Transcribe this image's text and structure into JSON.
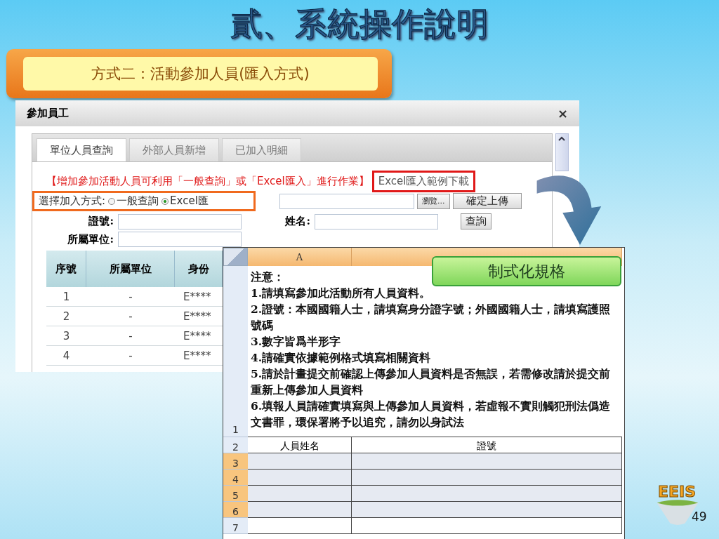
{
  "slide": {
    "title": "貳、系統操作說明",
    "callout": "方式二：活動參加人員(匯入方式)",
    "logo": "EEIS",
    "page_number": "49"
  },
  "dialog": {
    "title": "參加員工",
    "close": "×",
    "tabs": [
      {
        "label": "單位人員查詢",
        "selected": true
      },
      {
        "label": "外部人員新增",
        "selected": false
      },
      {
        "label": "已加入明細",
        "selected": false
      }
    ],
    "notice": "【增加參加活動人員可利用「一般查詢」或「Excel匯入」進行作業】",
    "sample_link": "Excel匯入範例下載",
    "mode_label": "選擇加入方式:",
    "modes": [
      {
        "label": "一般查詢",
        "selected": false
      },
      {
        "label": "Excel匯",
        "selected": true
      }
    ],
    "browse_button": "瀏覽...",
    "upload_button": "確定上傳",
    "id_label": "證號:",
    "name_label": "姓名:",
    "search_button": "查詢",
    "unit_label": "所屬單位:",
    "table": {
      "columns": [
        "序號",
        "所屬單位",
        "身份"
      ],
      "rows": [
        [
          "1",
          "-",
          "E****"
        ],
        [
          "2",
          "-",
          "E****"
        ],
        [
          "3",
          "-",
          "E****"
        ],
        [
          "4",
          "-",
          "E****"
        ]
      ]
    }
  },
  "spreadsheet": {
    "column": "A",
    "label": "制式化規格",
    "note_row": {
      "number": "1",
      "lines": [
        "注意：",
        "1.請填寫參加此活動所有人員資料。",
        "2.證號：本國國籍人士，請填寫身分證字號；外國國籍人士，請填寫護照號碼",
        "3.數字皆爲半形字",
        "4.請確實依據範例格式填寫相關資料",
        "5.請於計畫提交前確認上傳參加人員資料是否無誤，若需修改請於提交前重新上傳參加人員資料",
        "6.填報人員請確實填寫與上傳參加人員資料，若虛報不實則觸犯刑法僞造文書罪，環保署將予以追究，請勿以身試法"
      ]
    },
    "header_row": {
      "number": "2",
      "cells": [
        "人員姓名",
        "證號"
      ]
    },
    "rows": [
      {
        "number": "3",
        "selected": true
      },
      {
        "number": "4",
        "selected": true
      },
      {
        "number": "5",
        "selected": true
      },
      {
        "number": "6",
        "selected": true
      },
      {
        "number": "7",
        "selected": false
      }
    ]
  }
}
